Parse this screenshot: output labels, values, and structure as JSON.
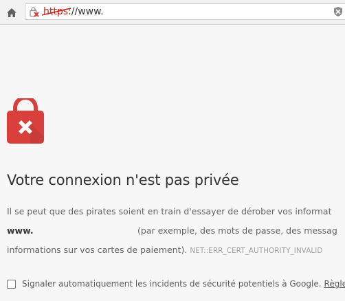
{
  "toolbar": {
    "url_scheme": "https",
    "url_rest": "://www."
  },
  "error": {
    "title": "Votre connexion n'est pas privée",
    "line1": "Il se peut que des pirates soient en train d'essayer de dérober vos informat",
    "host": "www.",
    "line2_rest": "(par exemple, des mots de passe, des messag",
    "line3": "informations sur vos cartes de paiement).",
    "code": "NET::ERR_CERT_AUTHORITY_INVALID"
  },
  "report": {
    "label": "Signaler automatiquement les incidents de sécurité potentiels à Google.",
    "link": "Règles d"
  },
  "colors": {
    "accent_red": "#d9403c",
    "url_red": "#c5211a"
  }
}
